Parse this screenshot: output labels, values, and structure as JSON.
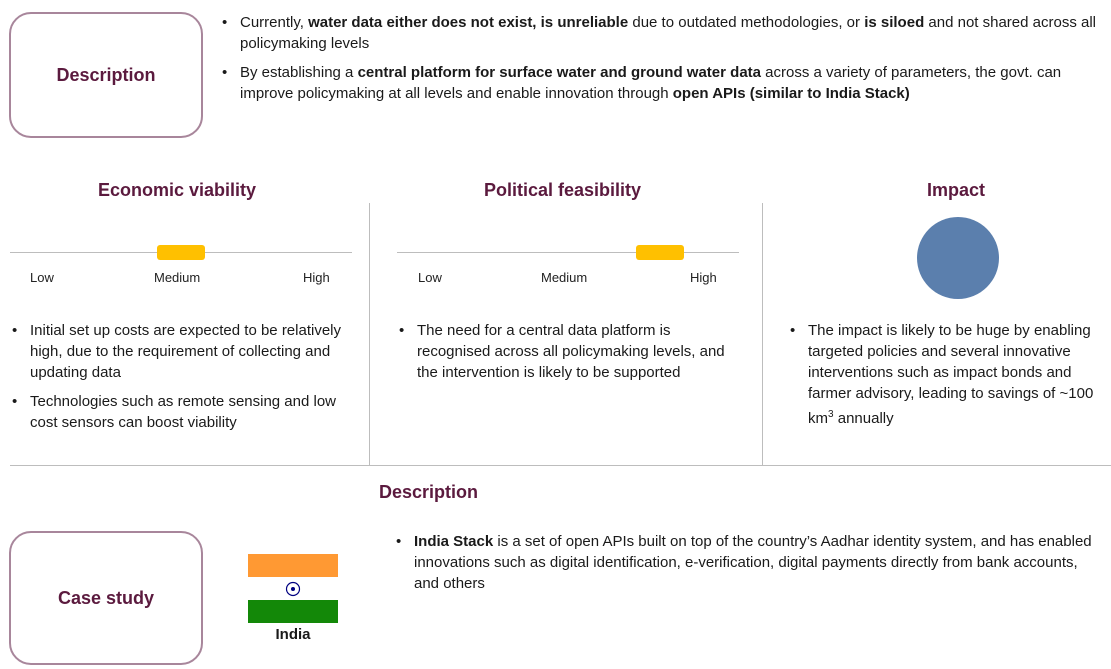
{
  "description_box": {
    "label": "Description"
  },
  "top_bullets": [
    {
      "segments": [
        {
          "text": "Currently, ",
          "bold": false
        },
        {
          "text": "water data either does not exist, is unreliable",
          "bold": true
        },
        {
          "text": " due to outdated methodologies, or ",
          "bold": false
        },
        {
          "text": "is siloed",
          "bold": true
        },
        {
          "text": " and not shared across all policymaking levels",
          "bold": false
        }
      ]
    },
    {
      "segments": [
        {
          "text": "By establishing a ",
          "bold": false
        },
        {
          "text": "central platform for surface water and ground water data",
          "bold": true
        },
        {
          "text": " across a variety of parameters, the govt. can improve policymaking at all levels and enable innovation through ",
          "bold": false
        },
        {
          "text": "open APIs (similar to India Stack)",
          "bold": true
        }
      ]
    }
  ],
  "columns": {
    "economic": {
      "title": "Economic viability",
      "scale": {
        "low": "Low",
        "medium": "Medium",
        "high": "High"
      },
      "level": 0.5,
      "bullets": [
        "Initial set up costs are expected to be relatively high, due to the requirement of collecting and updating data",
        "Technologies such as remote sensing and low cost sensors can boost viability"
      ]
    },
    "political": {
      "title": "Political feasibility",
      "scale": {
        "low": "Low",
        "medium": "Medium",
        "high": "High"
      },
      "level": 0.82,
      "bullets": [
        "The need for a central data platform is recognised across all policymaking levels, and the intervention is likely to be supported"
      ]
    },
    "impact": {
      "title": "Impact",
      "circle_color": "#5b7fad",
      "bullet_text_before_sup": "The impact is likely to be huge by enabling targeted policies and several innovative interventions such as impact bonds and farmer advisory, leading to savings of ~100 km",
      "bullet_sup": "3",
      "bullet_text_after_sup": " annually"
    }
  },
  "case_study": {
    "box_label": "Case study",
    "flag_label": "India",
    "section_title": "Description",
    "bullet_bold": "India Stack",
    "bullet_rest": " is a set of open APIs built on top of the country’s Aadhar identity system, and has enabled innovations such as digital identification, e-verification, digital payments directly from bank accounts, and others"
  },
  "colors": {
    "accent": "#5b1a3e",
    "border": "#a8869b",
    "indicator": "#ffc000",
    "flag_saffron": "#ff9933",
    "flag_green": "#138808",
    "chakra": "#000080"
  }
}
